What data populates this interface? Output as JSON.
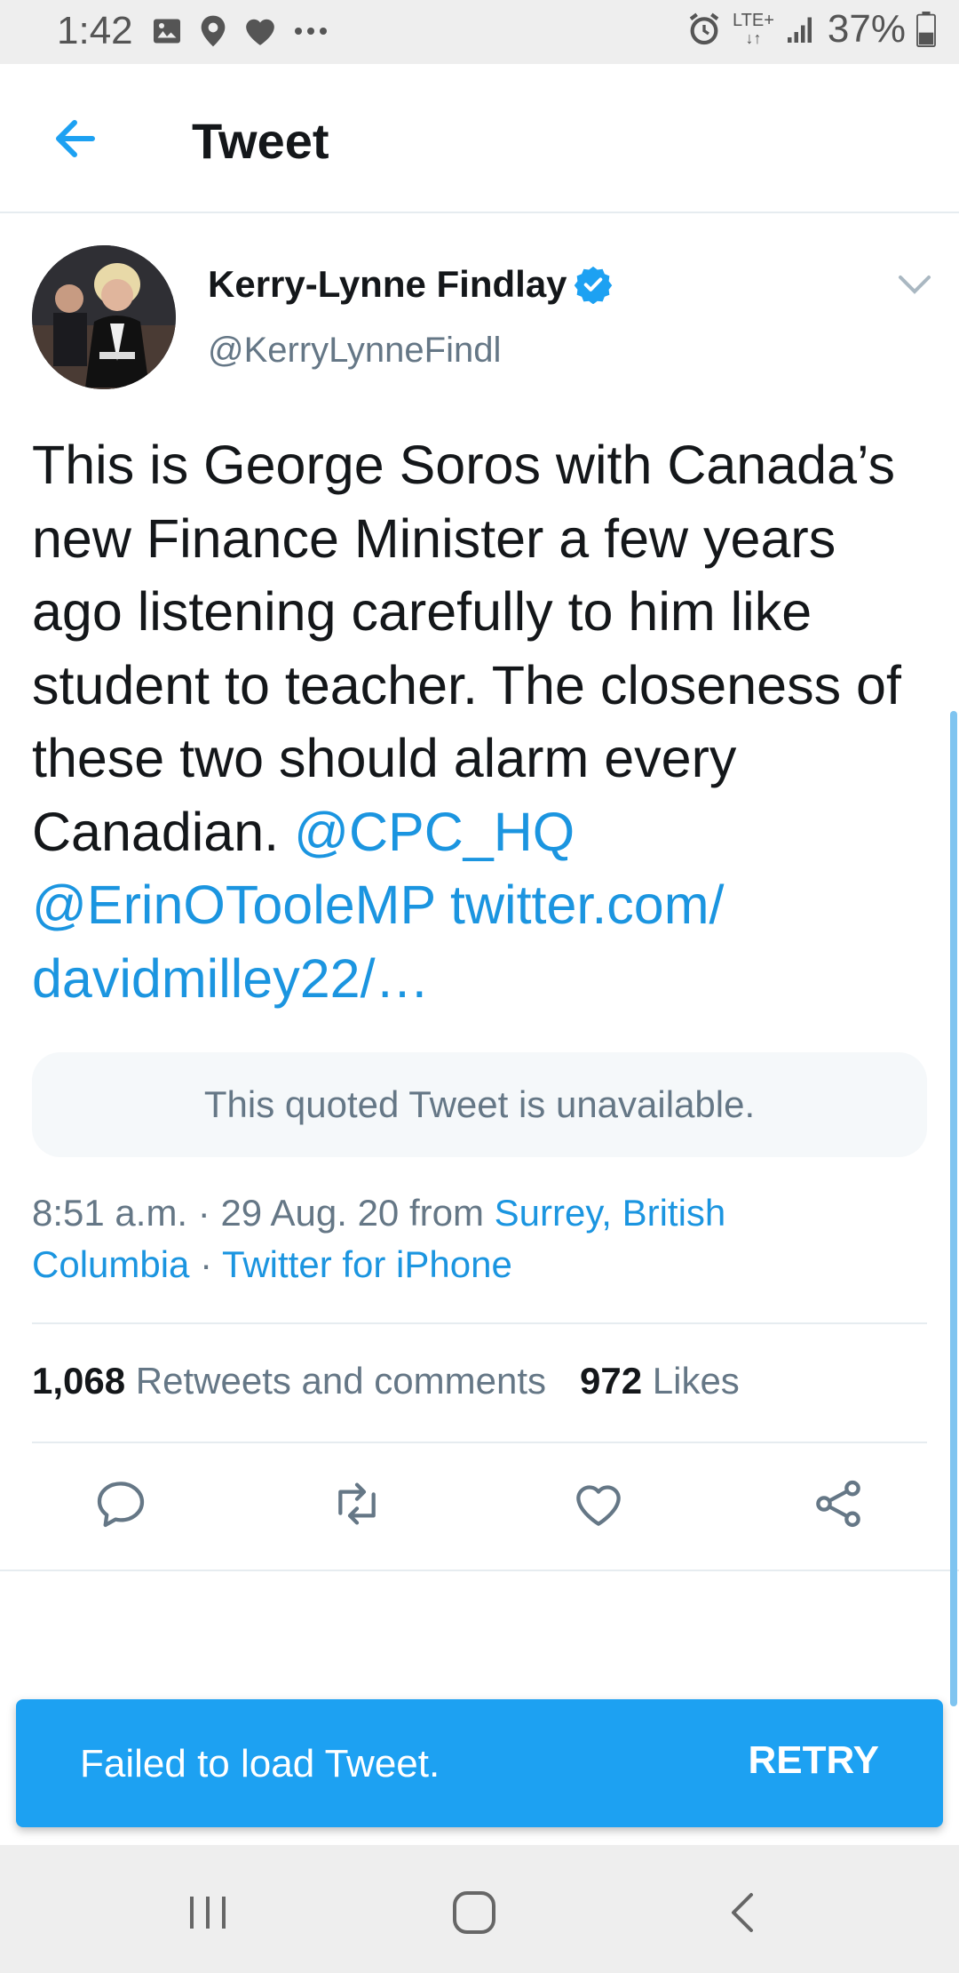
{
  "status_bar": {
    "time": "1:42",
    "battery": "37%",
    "left_icons": [
      "image-icon",
      "location-pin-icon",
      "heart-icon",
      "more-dots-icon"
    ],
    "right_icons": [
      "alarm-icon",
      "lte-icon",
      "signal-icon",
      "battery-icon"
    ],
    "network_label": "LTE+"
  },
  "app_bar": {
    "title": "Tweet"
  },
  "tweet": {
    "author_name": "Kerry-Lynne Findlay",
    "author_handle": "@KerryLynneFindl",
    "text": "This is George Soros with Canada’s new Finance Minister a few years ago listening carefully to him like student to teacher.  The closeness of these two should alarm every Canadian.",
    "mentions": [
      "@CPC_HQ",
      "@ErinOTooleMP"
    ],
    "link": "twitter.com/davidmilley22/…",
    "link_part1": "twitter.com/",
    "link_part2": "davidmilley22/…",
    "quoted_unavailable": "This quoted Tweet is unavailable.",
    "time": "8:51 a.m.",
    "date": "29 Aug. 20",
    "from_label": "from",
    "location_part1": "Surrey, British",
    "location_part2": "Columbia",
    "source": "Twitter for iPhone",
    "retweets_count": "1,068",
    "retweets_label": "Retweets and comments",
    "likes_count": "972",
    "likes_label": "Likes"
  },
  "snackbar": {
    "message": "Failed to load Tweet.",
    "action": "RETRY"
  },
  "colors": {
    "accent": "#1da1f2",
    "link": "#1b95e0",
    "muted": "#657786",
    "text": "#14171a"
  }
}
